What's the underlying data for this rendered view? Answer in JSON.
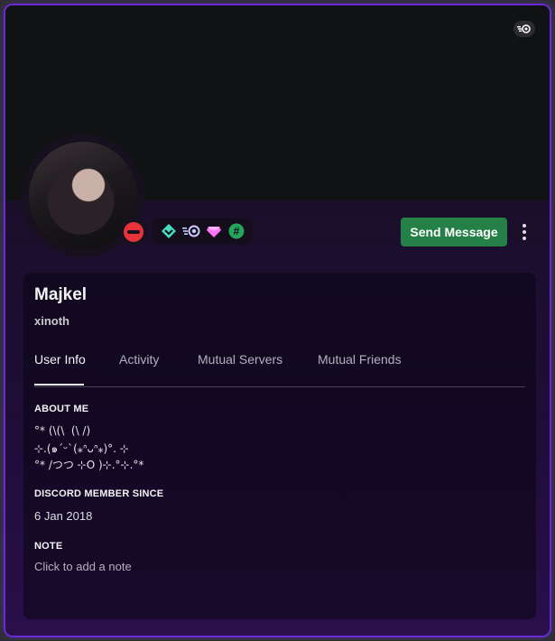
{
  "profile": {
    "display_name": "Majkel",
    "username": "xinoth",
    "status": "do-not-disturb",
    "colors": {
      "banner": "#111214",
      "send_button": "#248046",
      "status_dnd": "#e8333a",
      "theme_accent": "#6a2bd6"
    },
    "badges": [
      "hypesquad-balance-icon",
      "nitro-icon",
      "server-booster-icon",
      "pomelo-hash-icon"
    ]
  },
  "actions": {
    "send_message_label": "Send Message",
    "more_icon": "vertical-ellipsis-icon"
  },
  "tabs": [
    {
      "label": "User Info",
      "active": true
    },
    {
      "label": "Activity",
      "active": false
    },
    {
      "label": "Mutual Servers",
      "active": false
    },
    {
      "label": "Mutual Friends",
      "active": false
    }
  ],
  "about": {
    "title": "ABOUT ME",
    "lines": [
      "°* (\\(\\  (\\ /)",
      "⊹.(๑ˊᵕˋ(⁎ᐢᴗᐢ⁎)°. ⊹",
      "°* /つつ ⊹O )⊹.°⊹.°*"
    ]
  },
  "member_since": {
    "title": "DISCORD MEMBER SINCE",
    "date": "6 Jan 2018"
  },
  "note": {
    "title": "NOTE",
    "placeholder": "Click to add a note"
  }
}
